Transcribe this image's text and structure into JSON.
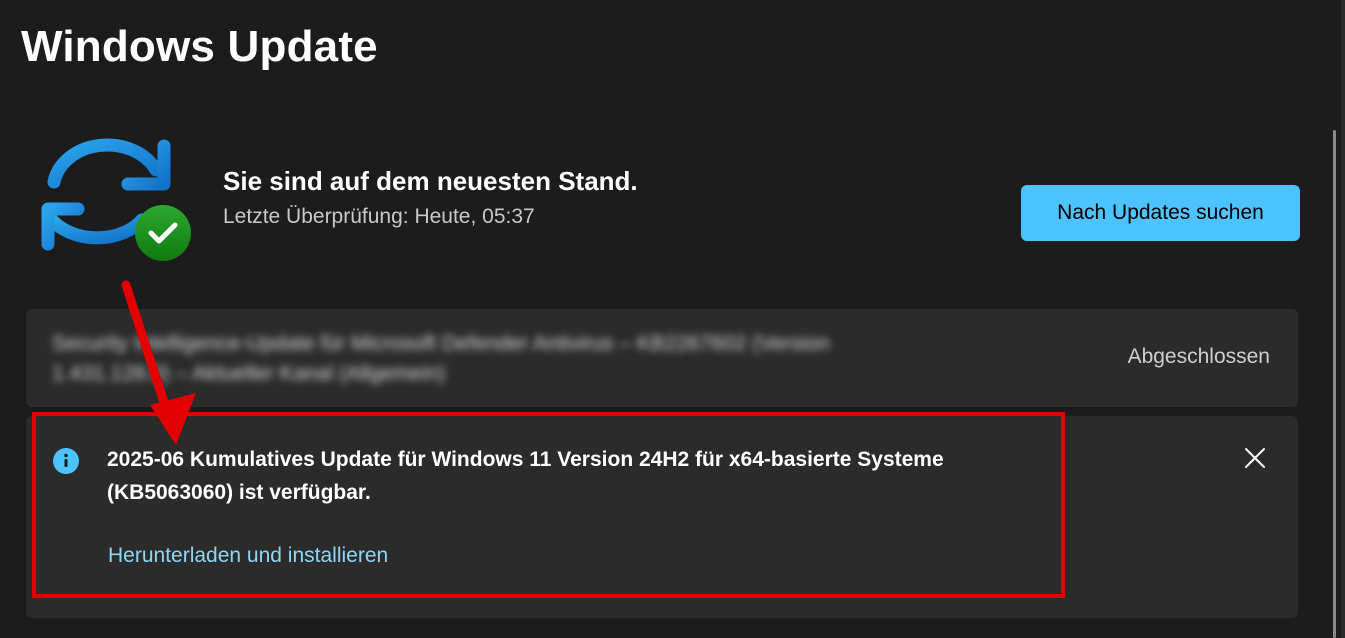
{
  "page": {
    "title": "Windows Update"
  },
  "status": {
    "title": "Sie sind auf dem neuesten Stand.",
    "subtitle": "Letzte Überprüfung: Heute, 05:37",
    "check_button_label": "Nach Updates suchen"
  },
  "update_history": {
    "items": [
      {
        "name": "Security Intelligence-Update für Microsoft Defender Antivirus – KB2267602 (Version 1.431.128.0) – Aktueller Kanal (Allgemein)",
        "status": "Abgeschlossen"
      }
    ]
  },
  "available_update": {
    "message": "2025-06 Kumulatives Update für Windows 11 Version 24H2 für x64-basierte Systeme (KB5063060) ist verfügbar.",
    "action_label": "Herunterladen und installieren"
  },
  "colors": {
    "background": "#1c1c1c",
    "card": "#2b2b2b",
    "accent": "#4cc2ff",
    "link": "#8ed6f7",
    "success": "#13a10e",
    "annotation": "#e30000"
  },
  "icons": {
    "status": "sync-check-icon",
    "info": "info-icon",
    "dismiss": "close-icon"
  }
}
